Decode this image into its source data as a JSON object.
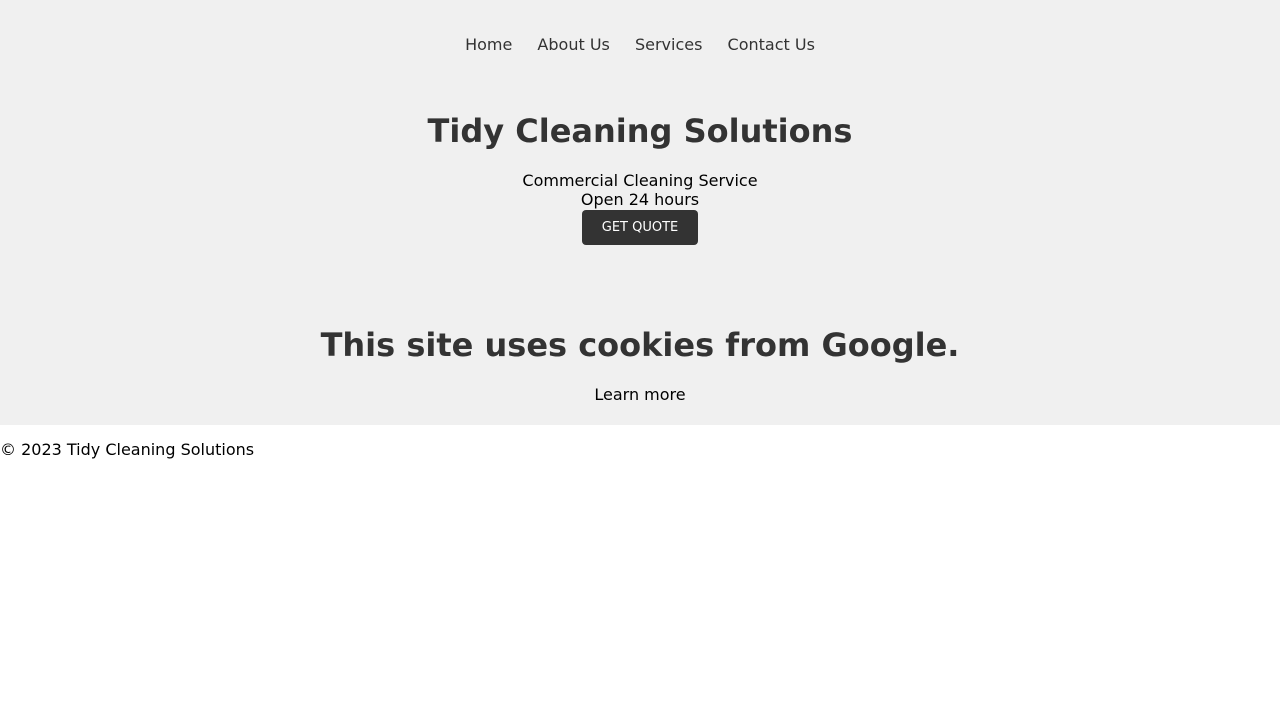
{
  "nav": {
    "items": [
      {
        "label": "Home"
      },
      {
        "label": "About Us"
      },
      {
        "label": "Services"
      },
      {
        "label": "Contact Us"
      }
    ]
  },
  "hero": {
    "title": "Tidy Cleaning Solutions",
    "subtitle_line1": "Commercial Cleaning Service",
    "subtitle_line2": "Open 24 hours",
    "button_label": "GET QUOTE"
  },
  "cookie_notice": {
    "title": "This site uses cookies from Google.",
    "link_label": "Learn more"
  },
  "footer": {
    "text": "© 2023 Tidy Cleaning Solutions"
  },
  "colors": {
    "panel_background": "#f0f0f0",
    "heading_text": "#333333",
    "button_background": "#333333",
    "button_text": "#ffffff"
  }
}
